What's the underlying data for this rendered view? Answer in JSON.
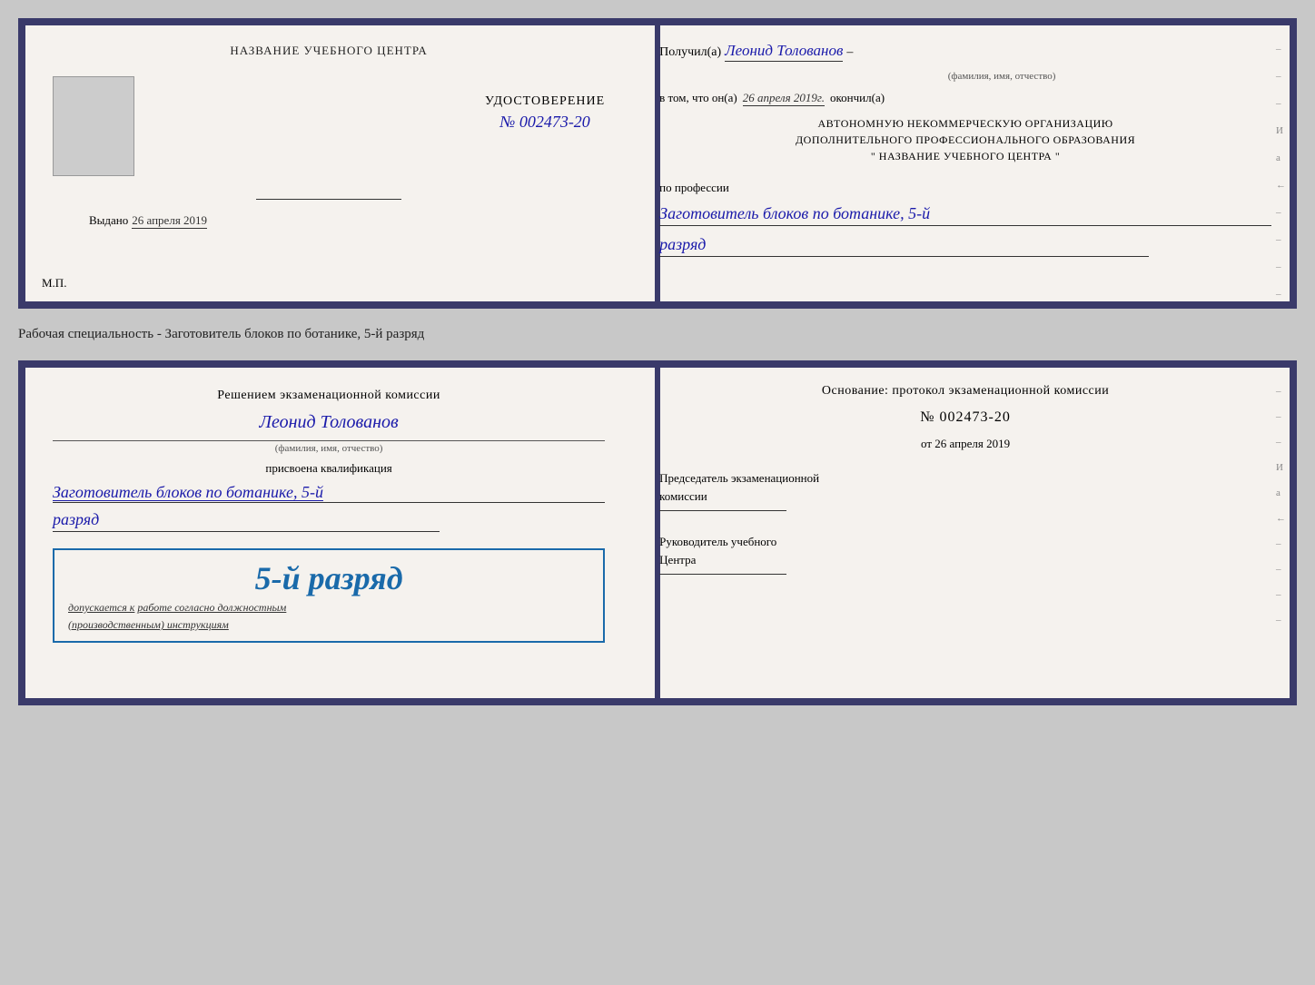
{
  "top_doc": {
    "left": {
      "header": "НАЗВАНИЕ УЧЕБНОГО ЦЕНТРА",
      "cert_title": "УДОСТОВЕРЕНИЕ",
      "cert_number": "№ 002473-20",
      "issued_label": "Выдано",
      "issued_date": "26 апреля 2019",
      "mp_label": "М.П."
    },
    "right": {
      "received_label": "Получил(а)",
      "received_name": "Леонид Толованов",
      "fio_hint": "(фамилия, имя, отчество)",
      "date_prefix": "в том, что он(а)",
      "date_value": "26 апреля 2019г.",
      "date_suffix": "окончил(а)",
      "org_line1": "АВТОНОМНУЮ НЕКОММЕРЧЕСКУЮ ОРГАНИЗАЦИЮ",
      "org_line2": "ДОПОЛНИТЕЛЬНОГО ПРОФЕССИОНАЛЬНОГО ОБРАЗОВАНИЯ",
      "org_line3": "\"    НАЗВАНИЕ УЧЕБНОГО ЦЕНТРА    \"",
      "profession_label": "по профессии",
      "profession_value": "Заготовитель блоков по ботанике, 5-й",
      "razryad_value": "разряд"
    }
  },
  "middle_text": "Рабочая специальность - Заготовитель блоков по ботанике, 5-й разряд",
  "bottom_doc": {
    "left": {
      "decision_line1": "Решением экзаменационной комиссии",
      "decision_name": "Леонид Толованов",
      "fio_hint": "(фамилия, имя, отчество)",
      "qualification_label": "присвоена квалификация",
      "qualification_value": "Заготовитель блоков по ботанике, 5-й",
      "razryad_value": "разряд",
      "stamp_grade": "5-й разряд",
      "stamp_allowed_prefix": "допускается к",
      "stamp_allowed_link": "работе согласно должностным",
      "stamp_allowed_suffix": "(производственным) инструкциям"
    },
    "right": {
      "basis_label": "Основание: протокол экзаменационной комиссии",
      "protocol_number": "№  002473-20",
      "from_prefix": "от",
      "from_date": "26 апреля 2019",
      "chair_label": "Председатель экзаменационной",
      "chair_label2": "комиссии",
      "director_label": "Руководитель учебного",
      "director_label2": "Центра"
    }
  },
  "dashes": [
    "-",
    "-",
    "-",
    "И",
    "а",
    "←",
    "-",
    "-",
    "-",
    "-"
  ]
}
